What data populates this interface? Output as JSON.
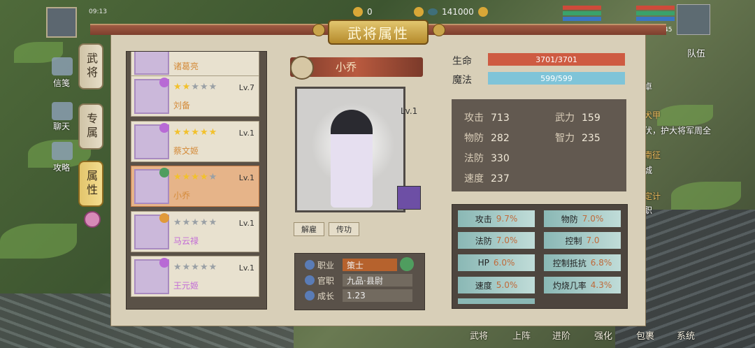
{
  "hud": {
    "time": "09:13",
    "gold": "0",
    "silver": "141000",
    "corner_number": "45",
    "right_labels": [
      "队伍"
    ]
  },
  "left_hud": [
    "信笺",
    "聊天",
    "攻略"
  ],
  "panel": {
    "title": "武将属性"
  },
  "side_tabs": [
    "武将",
    "专属",
    "属性"
  ],
  "heroes": [
    {
      "name": "诸葛亮",
      "stars": 0,
      "level": "",
      "name_color": "#d48b3a"
    },
    {
      "name": "刘备",
      "stars": 2,
      "level": "Lv.7",
      "name_color": "#d48b3a"
    },
    {
      "name": "蔡文姬",
      "stars": 5,
      "level": "Lv.1",
      "name_color": "#d48b3a"
    },
    {
      "name": "小乔",
      "stars": 4,
      "level": "Lv.1",
      "name_color": "#d48b3a"
    },
    {
      "name": "马云禄",
      "stars": 0,
      "level": "Lv.1",
      "name_color": "#c26bd6"
    },
    {
      "name": "王元姬",
      "stars": 0,
      "level": "Lv.1",
      "name_color": "#c26bd6"
    }
  ],
  "selected_hero": {
    "name": "小乔",
    "level": "Lv.1",
    "buttons": [
      "解雇",
      "传功"
    ],
    "info": [
      {
        "label": "职业",
        "value": "策士"
      },
      {
        "label": "官职",
        "value": "九品·县尉"
      },
      {
        "label": "成长",
        "value": "1.23"
      }
    ]
  },
  "vitals": {
    "hp_label": "生命",
    "hp_value": "3701/3701",
    "mp_label": "魔法",
    "mp_value": "599/599"
  },
  "stats": [
    {
      "label": "攻击",
      "value": "713"
    },
    {
      "label": "武力",
      "value": "159"
    },
    {
      "label": "物防",
      "value": "282"
    },
    {
      "label": "智力",
      "value": "235"
    },
    {
      "label": "法防",
      "value": "330"
    },
    {
      "label": "速度",
      "value": "237"
    }
  ],
  "bonuses": [
    {
      "label": "攻击",
      "value": "9.7%"
    },
    {
      "label": "物防",
      "value": "7.0%"
    },
    {
      "label": "法防",
      "value": "7.0%"
    },
    {
      "label": "控制",
      "value": "7.0"
    },
    {
      "label": "HP",
      "value": "6.0%"
    },
    {
      "label": "控制抵抗",
      "value": "6.8%"
    },
    {
      "label": "速度",
      "value": "5.0%"
    },
    {
      "label": "灼烧几率",
      "value": "4.3%"
    }
  ],
  "right_peek": [
    "卓",
    "犬甲",
    "伏，护大将军周全",
    "南征",
    "城",
    "定计",
    "职"
  ],
  "bottom_hud": [
    "武将",
    "上阵",
    "进阶",
    "强化",
    "包裹",
    "系统"
  ]
}
